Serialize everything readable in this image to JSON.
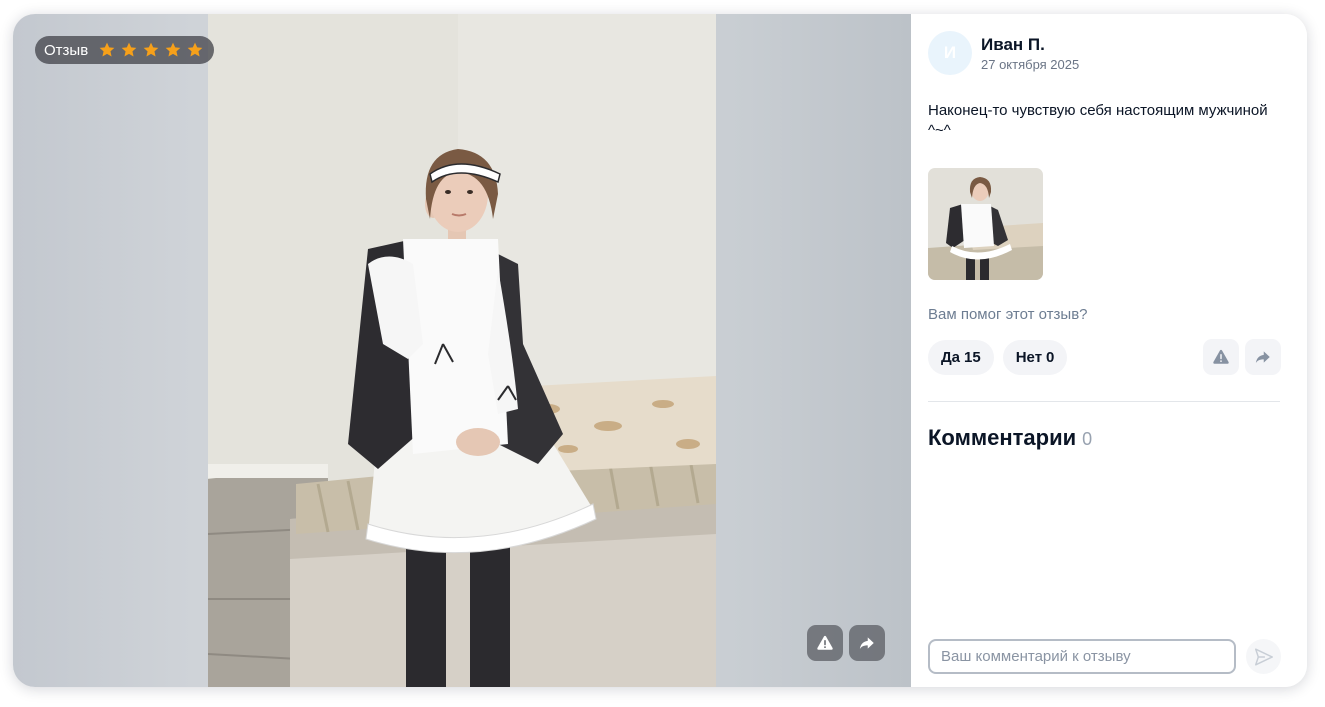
{
  "review_badge": {
    "label": "Отзыв",
    "rating": 5,
    "max_rating": 5
  },
  "author": {
    "avatar_initial": "И",
    "name": "Иван П.",
    "date": "27 октября 2025"
  },
  "review": {
    "text": "Наконец-то чувствую себя настоящим мужчиной ^~^"
  },
  "helpful": {
    "question": "Вам помог этот отзыв?",
    "yes_label": "Да",
    "yes_count": "15",
    "no_label": "Нет",
    "no_count": "0"
  },
  "comments": {
    "title": "Комментарии",
    "count": "0",
    "input_placeholder": "Ваш комментарий к отзыву"
  },
  "icons": {
    "report": "warning-icon",
    "share": "share-arrow-icon",
    "send": "send-icon",
    "star": "star-icon"
  },
  "colors": {
    "star": "#f6a01a",
    "title_text": "#0b1526",
    "muted_text": "#6d7d92"
  }
}
